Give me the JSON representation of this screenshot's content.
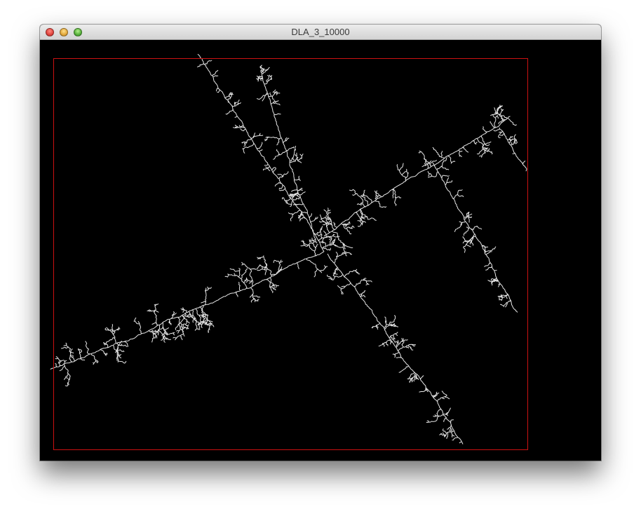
{
  "window": {
    "title": "DLA_3_10000"
  },
  "canvas": {
    "background": "#000000",
    "frame_color": "#cc1111",
    "particle_color": "#e6e6e6"
  },
  "icons": {
    "close": "close-icon",
    "minimize": "minimize-icon",
    "zoom": "zoom-icon"
  }
}
